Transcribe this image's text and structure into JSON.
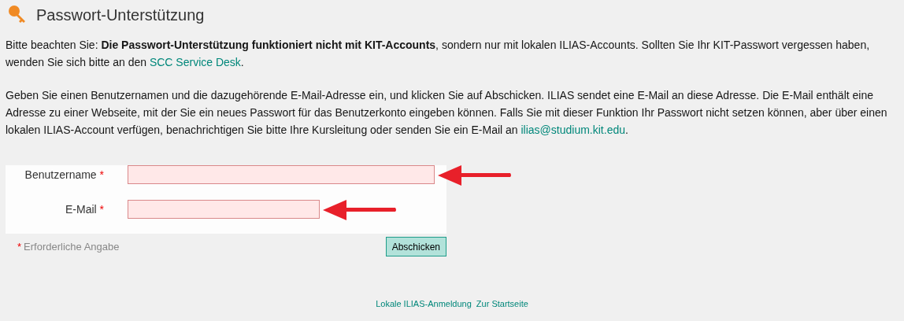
{
  "title": "Passwort-Unterstützung",
  "paragraphs": [
    {
      "text": "Bitte beachten Sie: **Die Passwort-Unterstützung funktioniert nicht mit KIT-Accounts**, sondern nur mit lokalen ILIAS-Accounts. Sollten Sie Ihr KIT-Passwort vergessen haben, wenden Sie sich bitte an den ",
      "link": "SCC Service Desk",
      "end": "."
    },
    {
      "text": "Geben Sie einen Benutzernamen und die dazugehörende E-Mail-Adresse ein, und klicken Sie auf Abschicken. ILIAS sendet eine E-Mail an diese Adresse. Die E-Mail enthält eine Adresse zu einer Webseite, mit der Sie ein neues Passwort für das Benutzerkonto eingeben können. Falls Sie mit dieser Funktion Ihr Passwort nicht setzen können, aber über einen lokalen ILIAS-Account verfügen, benachrichtigen Sie bitte Ihre Kursleitung oder senden Sie ein E-Mail an ",
      "link": "ilias@studium.kit.edu",
      "end": "."
    }
  ],
  "fields": [
    {
      "label": "Benutzername",
      "required_mark": "*",
      "kind": "wide",
      "arrow": true
    },
    {
      "label": "E-Mail",
      "required_mark": "*",
      "kind": "narrow",
      "arrow": true
    }
  ],
  "required_note": {
    "mark": "*",
    "text": "Erforderliche Angabe"
  },
  "submit_button": "Abschicken",
  "footer_links": [
    "Lokale ILIAS-Anmeldung",
    "Zur Startseite"
  ]
}
